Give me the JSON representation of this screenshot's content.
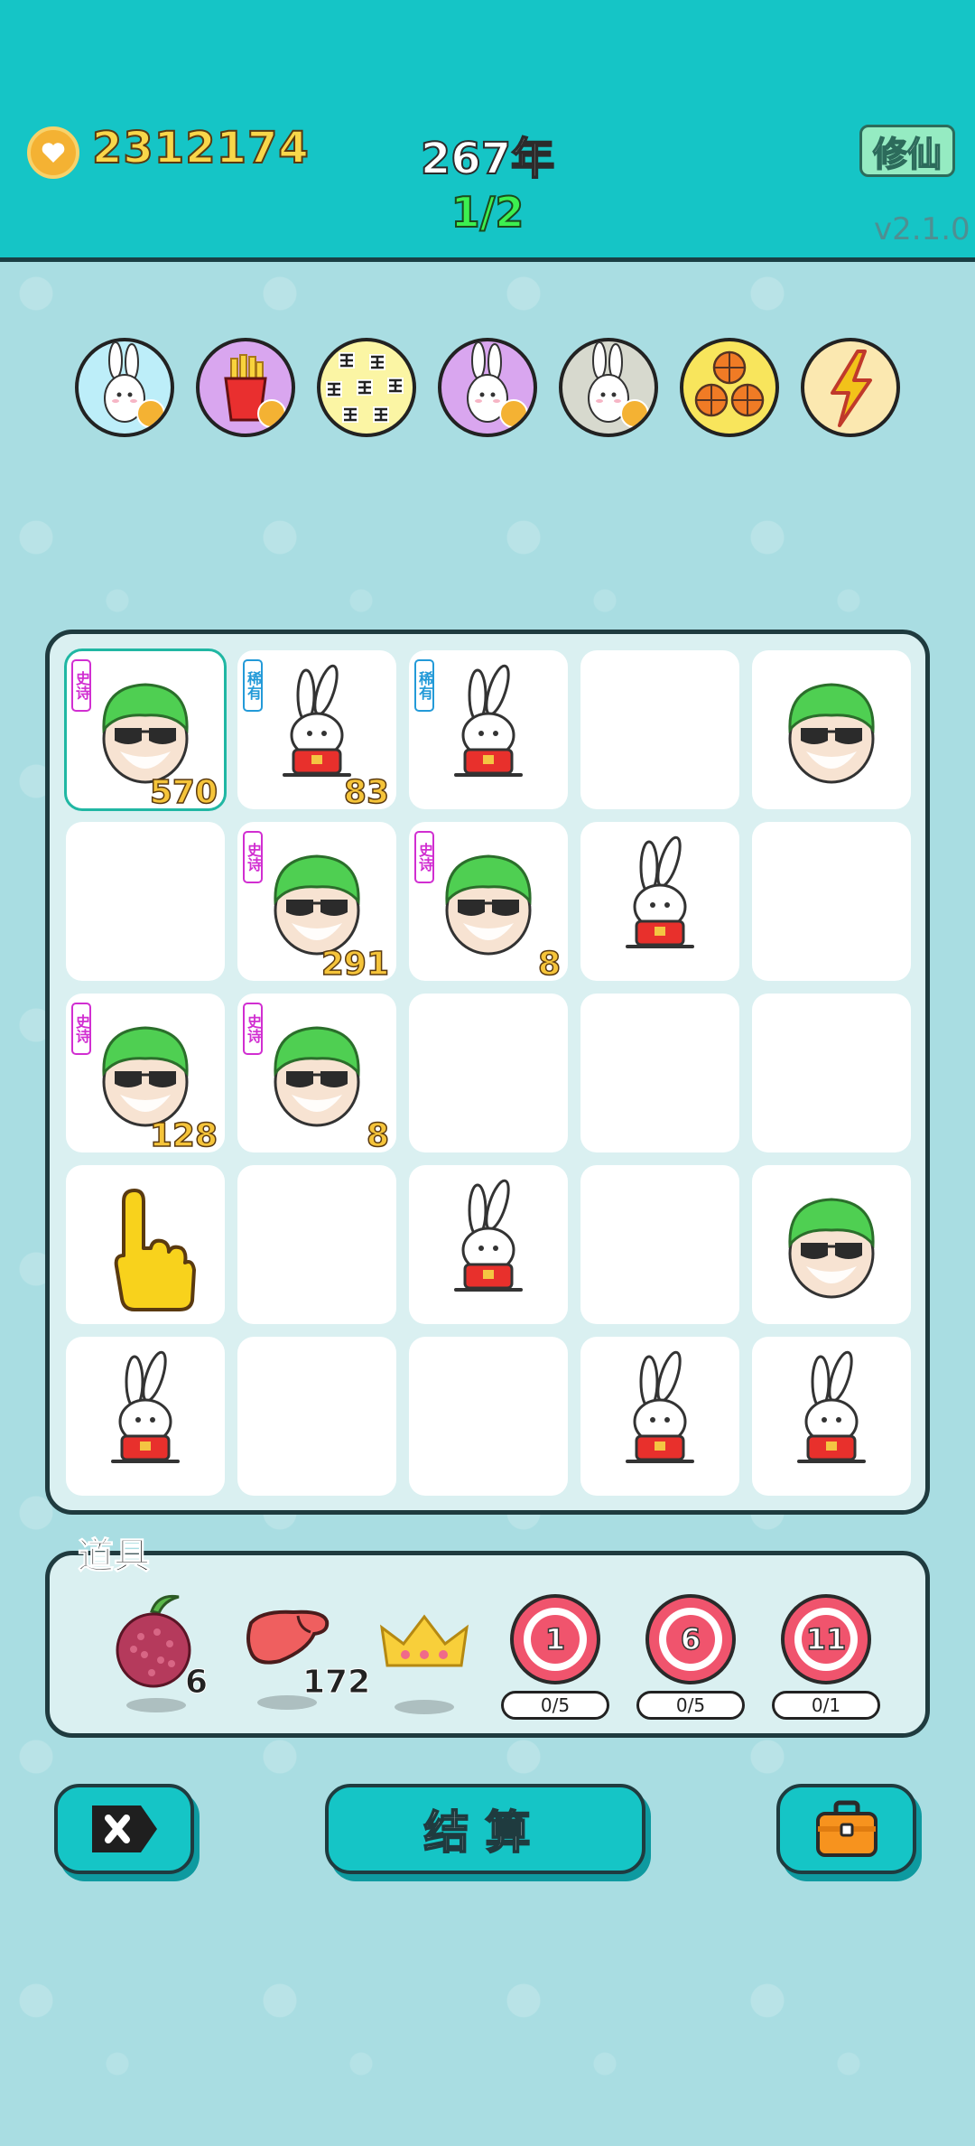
{
  "header": {
    "coins": "2312174",
    "year": "267年",
    "progress": "1/2",
    "cultivate_button": "修仙",
    "version": "v2.1.0"
  },
  "avatars": [
    {
      "name": "rabbit-blue",
      "bg": "#bdeef9"
    },
    {
      "name": "fries",
      "bg": "#d9a6ef"
    },
    {
      "name": "wang-pattern",
      "bg": "#fbf5a4"
    },
    {
      "name": "rabbit-purple",
      "bg": "#d9a6ef"
    },
    {
      "name": "rabbit-grey",
      "bg": "#d7d9ce"
    },
    {
      "name": "basketballs",
      "bg": "#f8e55c"
    },
    {
      "name": "lightning",
      "bg": "#fbe8b0"
    }
  ],
  "board": {
    "cells": [
      {
        "figure": "man",
        "tag": "史诗",
        "tag_type": "epic",
        "count": "570",
        "selected": true
      },
      {
        "figure": "rabbit",
        "tag": "稀有",
        "tag_type": "rare",
        "count": "83"
      },
      {
        "figure": "rabbit",
        "tag": "稀有",
        "tag_type": "rare",
        "count": ""
      },
      {
        "figure": "",
        "tag": "",
        "count": ""
      },
      {
        "figure": "man",
        "tag": "",
        "count": ""
      },
      {
        "figure": "",
        "tag": "",
        "count": ""
      },
      {
        "figure": "man",
        "tag": "史诗",
        "tag_type": "epic",
        "count": "291"
      },
      {
        "figure": "man",
        "tag": "史诗",
        "tag_type": "epic",
        "count": "8"
      },
      {
        "figure": "rabbit",
        "tag": "",
        "count": ""
      },
      {
        "figure": "",
        "tag": "",
        "count": ""
      },
      {
        "figure": "man",
        "tag": "史诗",
        "tag_type": "epic",
        "count": "128"
      },
      {
        "figure": "man",
        "tag": "史诗",
        "tag_type": "epic",
        "count": "8"
      },
      {
        "figure": "",
        "tag": "",
        "count": ""
      },
      {
        "figure": "",
        "tag": "",
        "count": ""
      },
      {
        "figure": "",
        "tag": "",
        "count": ""
      },
      {
        "figure": "hand",
        "tag": "",
        "count": ""
      },
      {
        "figure": "",
        "tag": "",
        "count": ""
      },
      {
        "figure": "rabbit",
        "tag": "",
        "count": ""
      },
      {
        "figure": "",
        "tag": "",
        "count": ""
      },
      {
        "figure": "man",
        "tag": "",
        "count": ""
      },
      {
        "figure": "rabbit",
        "tag": "",
        "count": ""
      },
      {
        "figure": "",
        "tag": "",
        "count": ""
      },
      {
        "figure": "",
        "tag": "",
        "count": ""
      },
      {
        "figure": "rabbit",
        "tag": "",
        "count": ""
      },
      {
        "figure": "rabbit",
        "tag": "",
        "count": ""
      }
    ]
  },
  "props": {
    "title": "道具",
    "bayberry_count": "6",
    "liver_count": "172",
    "targets": [
      {
        "value": "1",
        "progress": "0/5"
      },
      {
        "value": "6",
        "progress": "0/5"
      },
      {
        "value": "11",
        "progress": "0/1"
      }
    ]
  },
  "bottom": {
    "settle_label": "结算"
  },
  "colors": {
    "header_bg": "#15c5c6",
    "page_bg": "#a9dde2",
    "accent": "#15c5c6"
  }
}
